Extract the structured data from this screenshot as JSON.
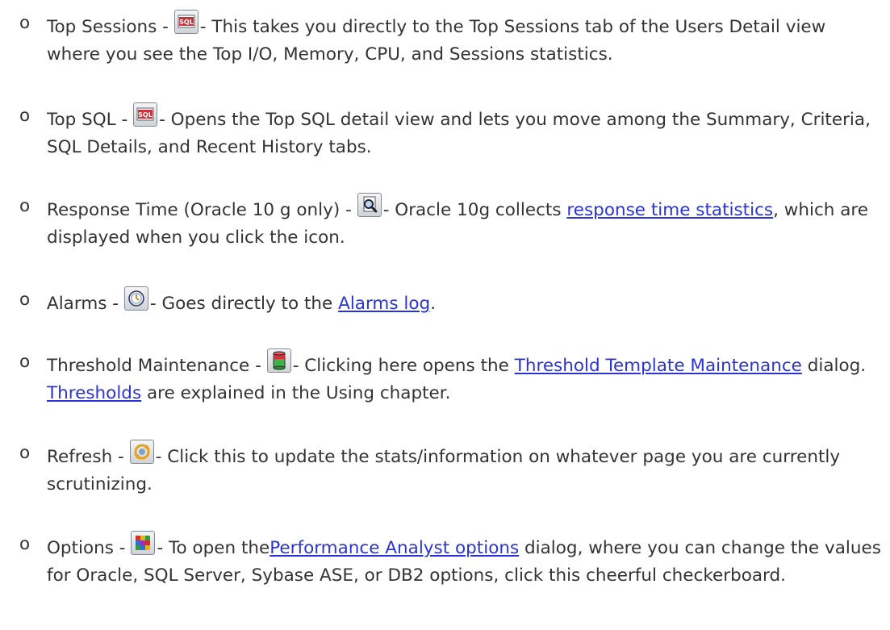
{
  "items": [
    {
      "bullet": "o",
      "label": "Top Sessions - ",
      "icon": "sql-icon",
      "after_icon": "- This takes you directly to the Top Sessions tab of the Users Detail view where you see the Top I/O, Memory, CPU, and Sessions statistics."
    },
    {
      "bullet": "o",
      "label": "Top SQL - ",
      "icon": "sql-icon",
      "after_icon": "- Opens the Top SQL detail view and lets you move among the Summary, Criteria, SQL Details, and Recent History tabs."
    },
    {
      "bullet": "o",
      "label": "Response Time (Oracle 10 g only) - ",
      "icon": "magnifier-icon",
      "after_icon": "- Oracle 10g collects ",
      "link": "response time statistics",
      "tail": ", which are displayed when you click the icon."
    },
    {
      "bullet": "o",
      "label": "Alarms - ",
      "icon": "alarm-clock-icon",
      "after_icon": "- Goes directly to the ",
      "link": "Alarms log",
      "tail": "."
    },
    {
      "bullet": "o",
      "label": "Threshold Maintenance - ",
      "icon": "threshold-cylinder-icon",
      "after_icon": "- Clicking here opens the ",
      "link": "Threshold Template Maintenance",
      "middle": " dialog. ",
      "link2": "Thresholds",
      "tail": " are explained in the Using chapter."
    },
    {
      "bullet": "o",
      "label": "Refresh - ",
      "icon": "refresh-icon",
      "after_icon": "- Click this to update the stats/information on whatever page you are currently scrutinizing."
    },
    {
      "bullet": "o",
      "label": "Options - ",
      "icon": "checkerboard-icon",
      "after_icon": "- To open the",
      "link": "Performance Analyst options",
      "tail": " dialog, where you can change the values for Oracle, SQL Server, Sybase ASE, or DB2 options, click this cheerful checkerboard."
    }
  ]
}
